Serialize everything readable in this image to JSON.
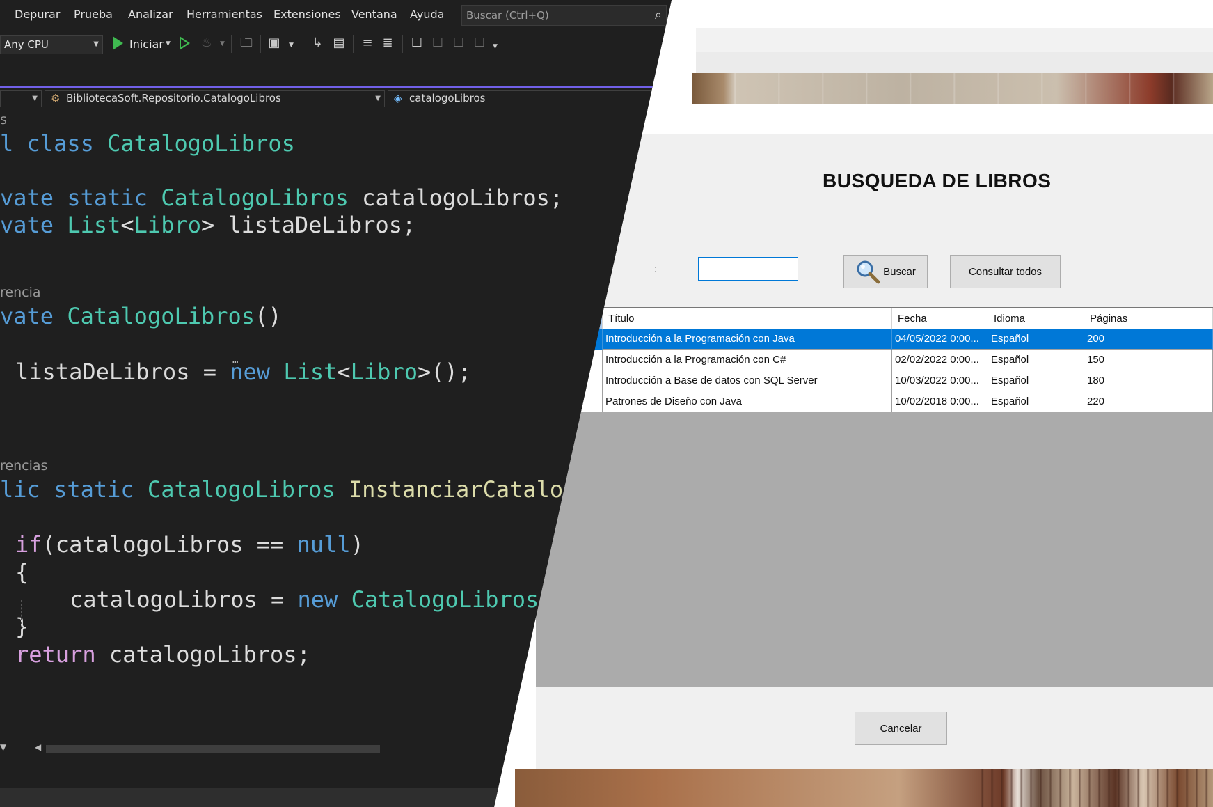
{
  "vs": {
    "menu": [
      {
        "pre": "",
        "u": "D",
        "post": "epurar"
      },
      {
        "pre": "P",
        "u": "r",
        "post": "ueba"
      },
      {
        "pre": "Anali",
        "u": "z",
        "post": "ar"
      },
      {
        "pre": "",
        "u": "H",
        "post": "erramientas"
      },
      {
        "pre": "E",
        "u": "x",
        "post": "tensiones"
      },
      {
        "pre": "Ve",
        "u": "n",
        "post": "tana"
      },
      {
        "pre": "Ay",
        "u": "u",
        "post": "da"
      }
    ],
    "search_placeholder": "Buscar (Ctrl+Q)",
    "platform": "Any CPU",
    "run_label": "Iniciar",
    "nav_class": "BibliotecaSoft.Repositorio.CatalogoLibros",
    "nav_member": "catalogoLibros",
    "codelens": {
      "top": "s",
      "ref1": "rencia",
      "ref2": "rencias"
    },
    "code": {
      "l1": [
        "l ",
        "class",
        " ",
        "CatalogoLibros"
      ],
      "l2": [
        "vate ",
        "static",
        " ",
        "CatalogoLibros",
        " catalogoLibros;"
      ],
      "l3": [
        "vate ",
        "List",
        "<",
        "Libro",
        "> ",
        "listaDeLibros",
        ";"
      ],
      "l4": [
        "vate ",
        "CatalogoLibros",
        "()"
      ],
      "l5": [
        "listaDeLibros = ",
        "new",
        " ",
        "List",
        "<",
        "Libro",
        ">();"
      ],
      "l6": [
        "lic ",
        "static",
        " ",
        "CatalogoLibros",
        " ",
        "InstanciarCatalo"
      ],
      "l7": [
        "if",
        "(catalogoLibros == ",
        "null",
        ")"
      ],
      "l8": "{",
      "l9": [
        "catalogoLibros = ",
        "new",
        " ",
        "CatalogoLibros"
      ],
      "l10": "}",
      "l11": [
        "return",
        " catalogoLibros;"
      ]
    }
  },
  "app": {
    "title": "BUSQUEDA DE LIBROS",
    "label_fragment": ":",
    "search_value": "",
    "buscar_label": "Buscar",
    "consultar_label": "Consultar todos",
    "cancelar_label": "Cancelar",
    "columns": [
      "Título",
      "Fecha",
      "Idioma",
      "Páginas"
    ],
    "rows": [
      {
        "titulo": "Introducción a la Programación con Java",
        "fecha": "04/05/2022 0:00...",
        "idioma": "Español",
        "paginas": "200",
        "selected": true
      },
      {
        "titulo": "Introducción a la Programación con C#",
        "fecha": "02/02/2022 0:00...",
        "idioma": "Español",
        "paginas": "150",
        "selected": false
      },
      {
        "titulo": "Introducción a Base de datos con SQL Server",
        "fecha": "10/03/2022 0:00...",
        "idioma": "Español",
        "paginas": "180",
        "selected": false
      },
      {
        "titulo": "Patrones de Diseño con Java",
        "fecha": "10/02/2018 0:00...",
        "idioma": "Español",
        "paginas": "220",
        "selected": false
      }
    ],
    "colors": {
      "selection": "#0078d7",
      "grid_bg": "#ababab",
      "form_bg": "#f0f0f0"
    }
  }
}
